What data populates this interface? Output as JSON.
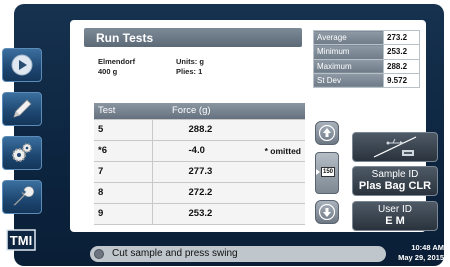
{
  "panel": {
    "title": "Run Tests",
    "instrument": "Elmendorf",
    "capacity": "400 g",
    "units": "Units: g",
    "plies": "Plies: 1"
  },
  "stats": [
    {
      "label": "Average",
      "value": "273.2"
    },
    {
      "label": "Minimum",
      "value": "253.2"
    },
    {
      "label": "Maximum",
      "value": "288.2"
    },
    {
      "label": "St Dev",
      "value": "9.572"
    }
  ],
  "results": {
    "headers": {
      "test": "Test",
      "force": "Force (g)"
    },
    "rows": [
      {
        "test": "5",
        "force": "288.2",
        "note": ""
      },
      {
        "test": "*6",
        "force": "-4.0",
        "note": "* omitted"
      },
      {
        "test": "7",
        "force": "277.3",
        "note": ""
      },
      {
        "test": "8",
        "force": "272.2",
        "note": ""
      },
      {
        "test": "9",
        "force": "253.2",
        "note": ""
      }
    ]
  },
  "page_indicator": "150",
  "sample_id": {
    "label": "Sample ID",
    "value": "Plas Bag CLR"
  },
  "user_id": {
    "label": "User ID",
    "value": "E M"
  },
  "status": {
    "message": "Cut sample and press swing"
  },
  "clock": {
    "time": "10:48 AM",
    "date": "May 29, 2015"
  },
  "logo": {
    "text": "TMI"
  },
  "icons": {
    "nav": [
      "play-icon",
      "pencil-icon",
      "gears-icon",
      "wrench-icon"
    ],
    "scroll": [
      "arrow-up-icon",
      "arrow-down-icon"
    ],
    "usb": "usb-icon"
  },
  "colors": {
    "frame": "#0d2540",
    "nav_button": "#1d4670",
    "header_gray": "#6f7b88"
  }
}
